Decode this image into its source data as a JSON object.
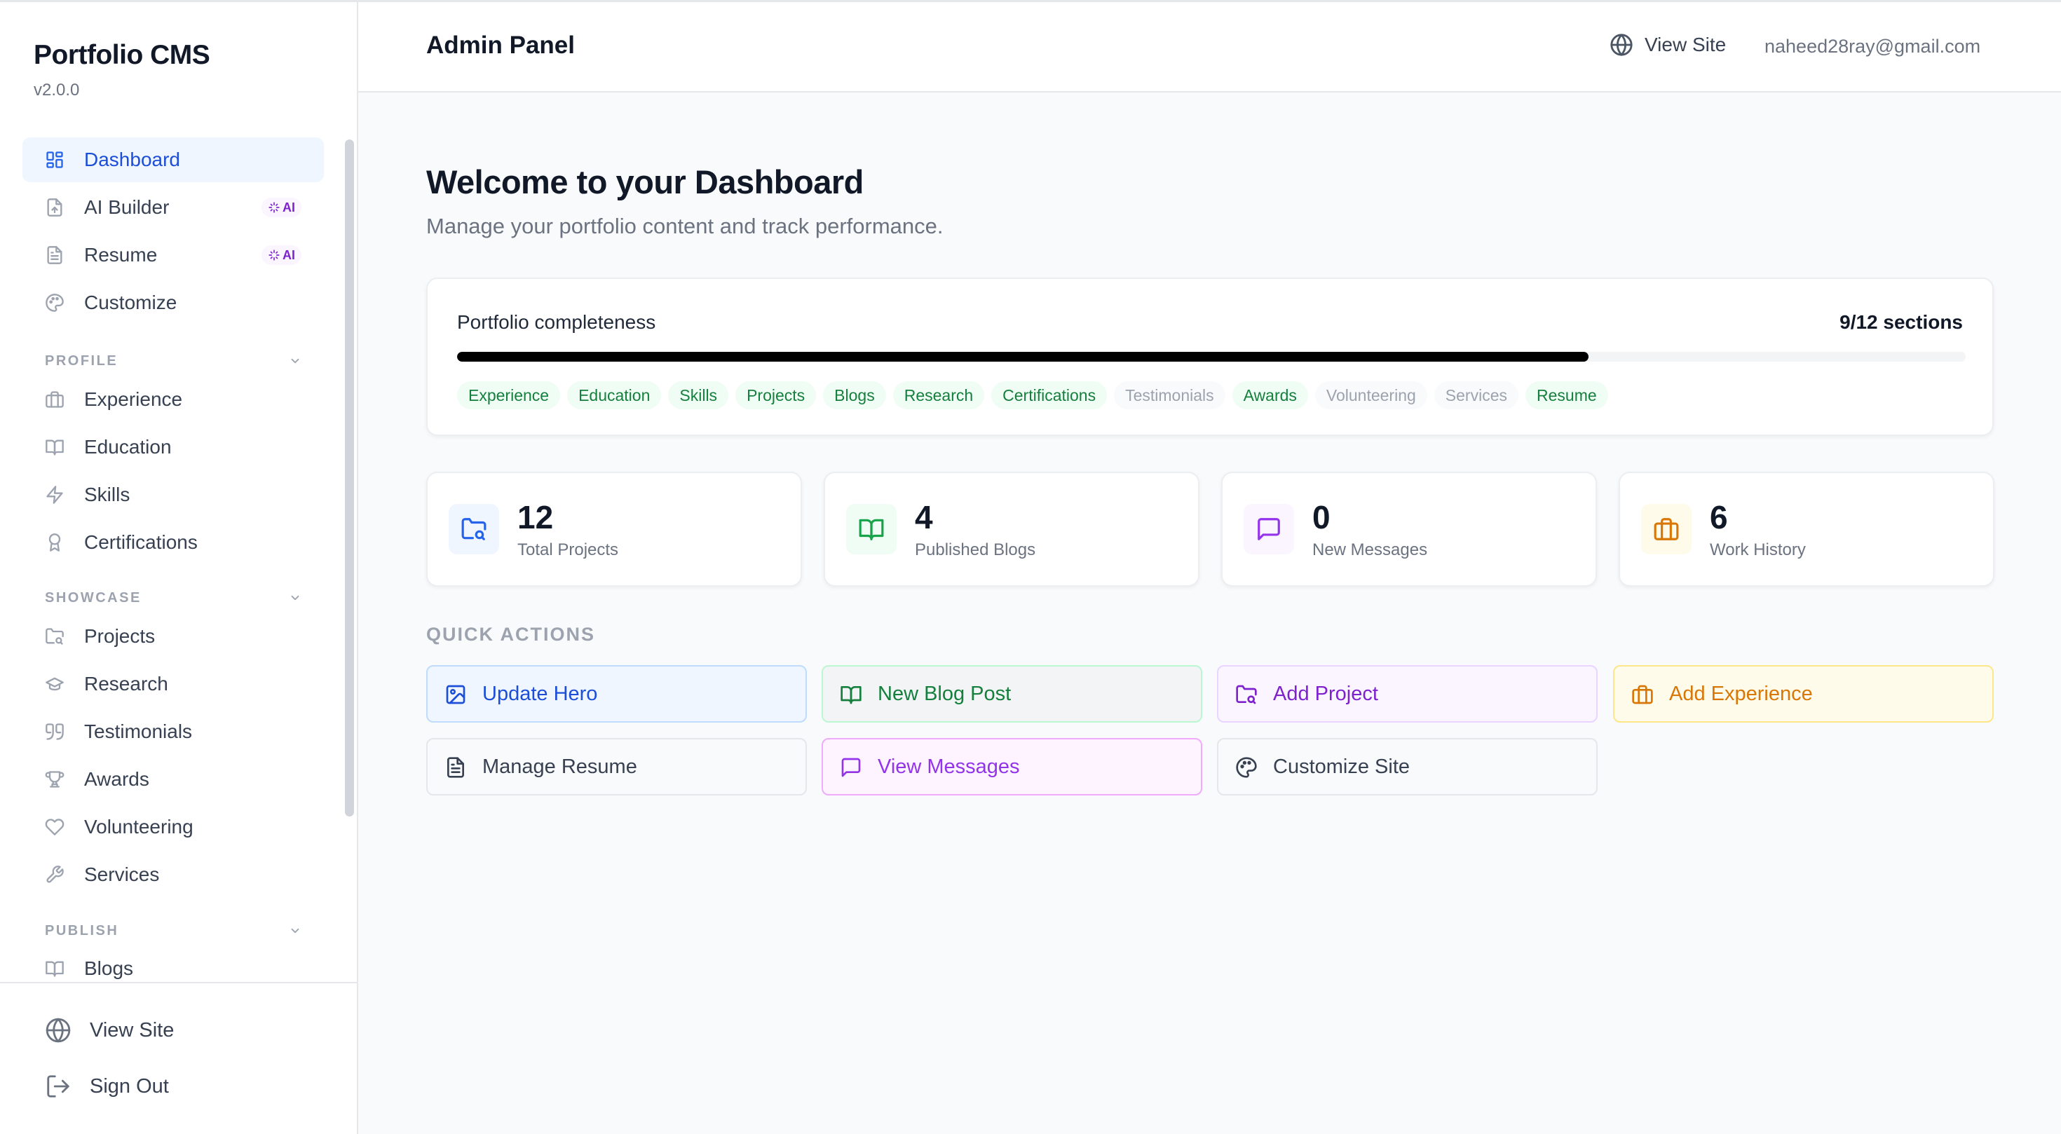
{
  "app": {
    "title": "Portfolio CMS",
    "version": "v2.0.0"
  },
  "sidebar": {
    "top_items": [
      {
        "label": "Dashboard",
        "icon": "dashboard-grid-icon",
        "active": true
      },
      {
        "label": "AI Builder",
        "icon": "file-upload-icon",
        "badge": "AI"
      },
      {
        "label": "Resume",
        "icon": "file-text-icon",
        "badge": "AI"
      },
      {
        "label": "Customize",
        "icon": "palette-icon"
      }
    ],
    "sections": [
      {
        "title": "PROFILE",
        "items": [
          {
            "label": "Experience",
            "icon": "briefcase-icon"
          },
          {
            "label": "Education",
            "icon": "book-open-icon"
          },
          {
            "label": "Skills",
            "icon": "zap-icon"
          },
          {
            "label": "Certifications",
            "icon": "award-icon"
          }
        ]
      },
      {
        "title": "SHOWCASE",
        "items": [
          {
            "label": "Projects",
            "icon": "folder-search-icon"
          },
          {
            "label": "Research",
            "icon": "graduation-cap-icon"
          },
          {
            "label": "Testimonials",
            "icon": "quote-icon"
          },
          {
            "label": "Awards",
            "icon": "trophy-icon"
          },
          {
            "label": "Volunteering",
            "icon": "heart-icon"
          },
          {
            "label": "Services",
            "icon": "wrench-icon"
          }
        ]
      },
      {
        "title": "PUBLISH",
        "items": [
          {
            "label": "Blogs",
            "icon": "book-open-icon"
          }
        ]
      }
    ],
    "footer": [
      {
        "label": "View Site",
        "icon": "globe-icon"
      },
      {
        "label": "Sign Out",
        "icon": "log-out-icon"
      }
    ]
  },
  "header": {
    "title": "Admin Panel",
    "view_site": "View Site",
    "email": "naheed28ray@gmail.com"
  },
  "main": {
    "title": "Welcome to your Dashboard",
    "subtitle": "Manage your portfolio content and track performance."
  },
  "completeness": {
    "label": "Portfolio completeness",
    "count_text": "9/12 sections",
    "completed": 9,
    "total": 12,
    "sections": [
      {
        "label": "Experience",
        "done": true
      },
      {
        "label": "Education",
        "done": true
      },
      {
        "label": "Skills",
        "done": true
      },
      {
        "label": "Projects",
        "done": true
      },
      {
        "label": "Blogs",
        "done": true
      },
      {
        "label": "Research",
        "done": true
      },
      {
        "label": "Certifications",
        "done": true
      },
      {
        "label": "Testimonials",
        "done": false
      },
      {
        "label": "Awards",
        "done": true
      },
      {
        "label": "Volunteering",
        "done": false
      },
      {
        "label": "Services",
        "done": false
      },
      {
        "label": "Resume",
        "done": true
      }
    ]
  },
  "stats": [
    {
      "value": "12",
      "label": "Total Projects",
      "icon": "folder-search-icon",
      "color": "#2563eb",
      "bg": "#eff6ff"
    },
    {
      "value": "4",
      "label": "Published Blogs",
      "icon": "book-open-icon",
      "color": "#16a34a",
      "bg": "#f0fdf4"
    },
    {
      "value": "0",
      "label": "New Messages",
      "icon": "message-square-icon",
      "color": "#9333ea",
      "bg": "#faf5ff"
    },
    {
      "value": "6",
      "label": "Work History",
      "icon": "briefcase-icon",
      "color": "#d97706",
      "bg": "#fffbeb"
    }
  ],
  "quick_actions": {
    "title": "QUICK ACTIONS",
    "items": [
      {
        "label": "Update Hero",
        "icon": "image-icon",
        "style": "blue"
      },
      {
        "label": "New Blog Post",
        "icon": "book-open-icon",
        "style": "green"
      },
      {
        "label": "Add Project",
        "icon": "folder-search-icon",
        "style": "purple"
      },
      {
        "label": "Add Experience",
        "icon": "briefcase-icon",
        "style": "amber"
      },
      {
        "label": "Manage Resume",
        "icon": "file-text-icon",
        "style": "gray"
      },
      {
        "label": "View Messages",
        "icon": "message-square-icon",
        "style": "pink"
      },
      {
        "label": "Customize Site",
        "icon": "palette-icon",
        "style": "gray"
      }
    ]
  },
  "colors": {
    "accent": "#2563eb",
    "progress": "#000000",
    "chip_done_text": "#15803d",
    "chip_todo_text": "#9ca3af"
  }
}
